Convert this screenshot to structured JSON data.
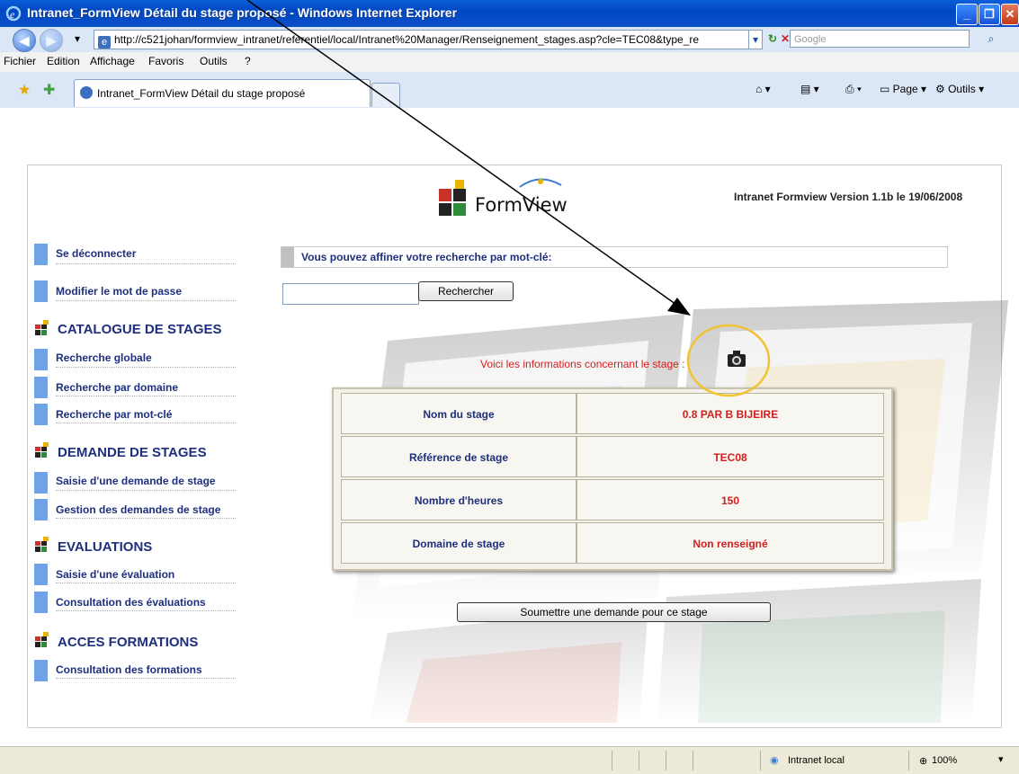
{
  "window": {
    "title": "Intranet_FormView Détail du stage proposé - Windows Internet Explorer"
  },
  "addressbar": {
    "url": "http://c521johan/formview_intranet/referentiel/local/Intranet%20Manager/Renseignement_stages.asp?cle=TEC08&type_re",
    "search_placeholder": "Google"
  },
  "menu": [
    "Fichier",
    "Edition",
    "Affichage",
    "Favoris",
    "Outils",
    "?"
  ],
  "tab": {
    "title": "Intranet_FormView Détail du stage proposé"
  },
  "toolbar": {
    "page_label": "Page",
    "tools_label": "Outils"
  },
  "header": {
    "logo_text": "FormView",
    "version": "Intranet Formview Version 1.1b le 19/06/2008"
  },
  "sidebar": {
    "logout": "Se déconnecter",
    "change_password": "Modifier le mot de passe",
    "sections": [
      {
        "title": "CATALOGUE DE STAGES",
        "items": [
          "Recherche globale",
          "Recherche par domaine",
          "Recherche par mot-clé"
        ]
      },
      {
        "title": "DEMANDE DE STAGES",
        "items": [
          "Saisie d'une demande de stage",
          "Gestion des demandes de stage"
        ]
      },
      {
        "title": "EVALUATIONS",
        "items": [
          "Saisie d'une évaluation",
          "Consultation des évaluations"
        ]
      },
      {
        "title": "ACCES FORMATIONS",
        "items": [
          "Consultation des formations"
        ]
      }
    ]
  },
  "search": {
    "prompt": "Vous pouvez affiner votre recherche par mot-clé:",
    "value": "",
    "button": "Rechercher"
  },
  "info": {
    "intro": "Voici les informations concernant le stage :",
    "rows": [
      {
        "label": "Nom du stage",
        "value": "0.8 PAR B BIJEIRE"
      },
      {
        "label": "Référence de stage",
        "value": "TEC08"
      },
      {
        "label": "Nombre d'heures",
        "value": "150"
      },
      {
        "label": "Domaine de stage",
        "value": "Non renseigné"
      }
    ]
  },
  "submit_button": "Soumettre une demande pour ce stage",
  "status": {
    "zone": "Intranet local",
    "zoom": "100%"
  },
  "colors": {
    "nav_text": "#1d2f7d",
    "value_text": "#d22020",
    "nav_bullet": "#6fa3e6",
    "highlight_circle": "#f1c232"
  }
}
